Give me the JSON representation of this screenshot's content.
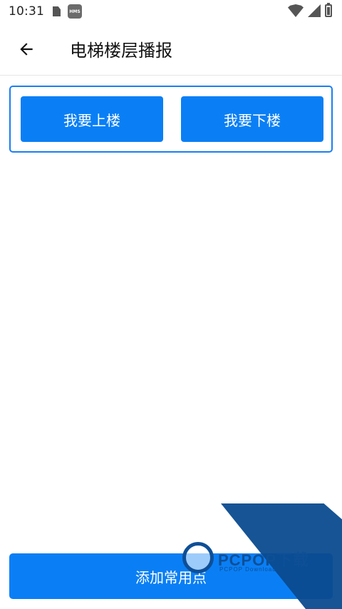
{
  "status_bar": {
    "time": "10:31",
    "hms_label": "HMS",
    "icons": [
      "sim-icon",
      "hms-icon",
      "wifi-icon",
      "signal-icon",
      "battery-icon"
    ]
  },
  "app_bar": {
    "back_icon": "arrow-left-icon",
    "title": "电梯楼层播报"
  },
  "actions": {
    "go_up_label": "我要上楼",
    "go_down_label": "我要下楼"
  },
  "footer": {
    "add_label": "添加常用点"
  },
  "watermark": {
    "brand": "PCPOP下载",
    "subtitle": "PCPOP Download"
  },
  "colors": {
    "primary": "#0a7ff5",
    "card_border": "#1a7ff0",
    "watermark": "#0b4b8f"
  }
}
